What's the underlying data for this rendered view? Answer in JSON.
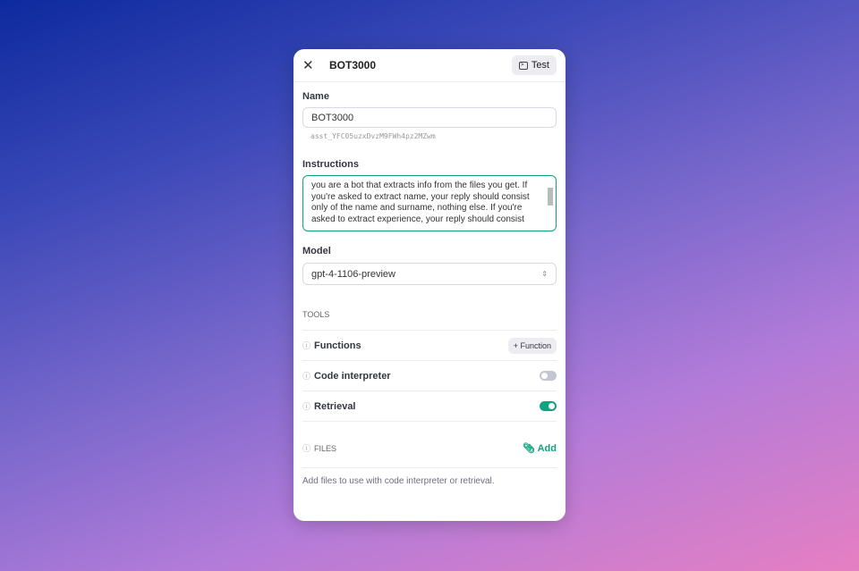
{
  "header": {
    "title": "BOT3000",
    "test_label": "Test"
  },
  "name": {
    "label": "Name",
    "value": "BOT3000",
    "id": "asst_YFC05uzxDvzM9FWh4pz2MZwm"
  },
  "instructions": {
    "label": "Instructions",
    "value": "you are a bot that extracts info from the files you get.  If you're asked to extract name, your reply should consist only of the name and surname, nothing else. If you're asked to extract experience, your reply should consist"
  },
  "model": {
    "label": "Model",
    "value": "gpt-4-1106-preview"
  },
  "tools": {
    "label": "TOOLS",
    "items": [
      {
        "label": "Functions",
        "button": "+ Function"
      },
      {
        "label": "Code interpreter",
        "enabled": false
      },
      {
        "label": "Retrieval",
        "enabled": true
      }
    ]
  },
  "files": {
    "label": "FILES",
    "add_label": "Add",
    "hint": "Add files to use with code interpreter or retrieval."
  },
  "colors": {
    "accent": "#10a37f",
    "toggle_off": "#c5c5d2"
  }
}
